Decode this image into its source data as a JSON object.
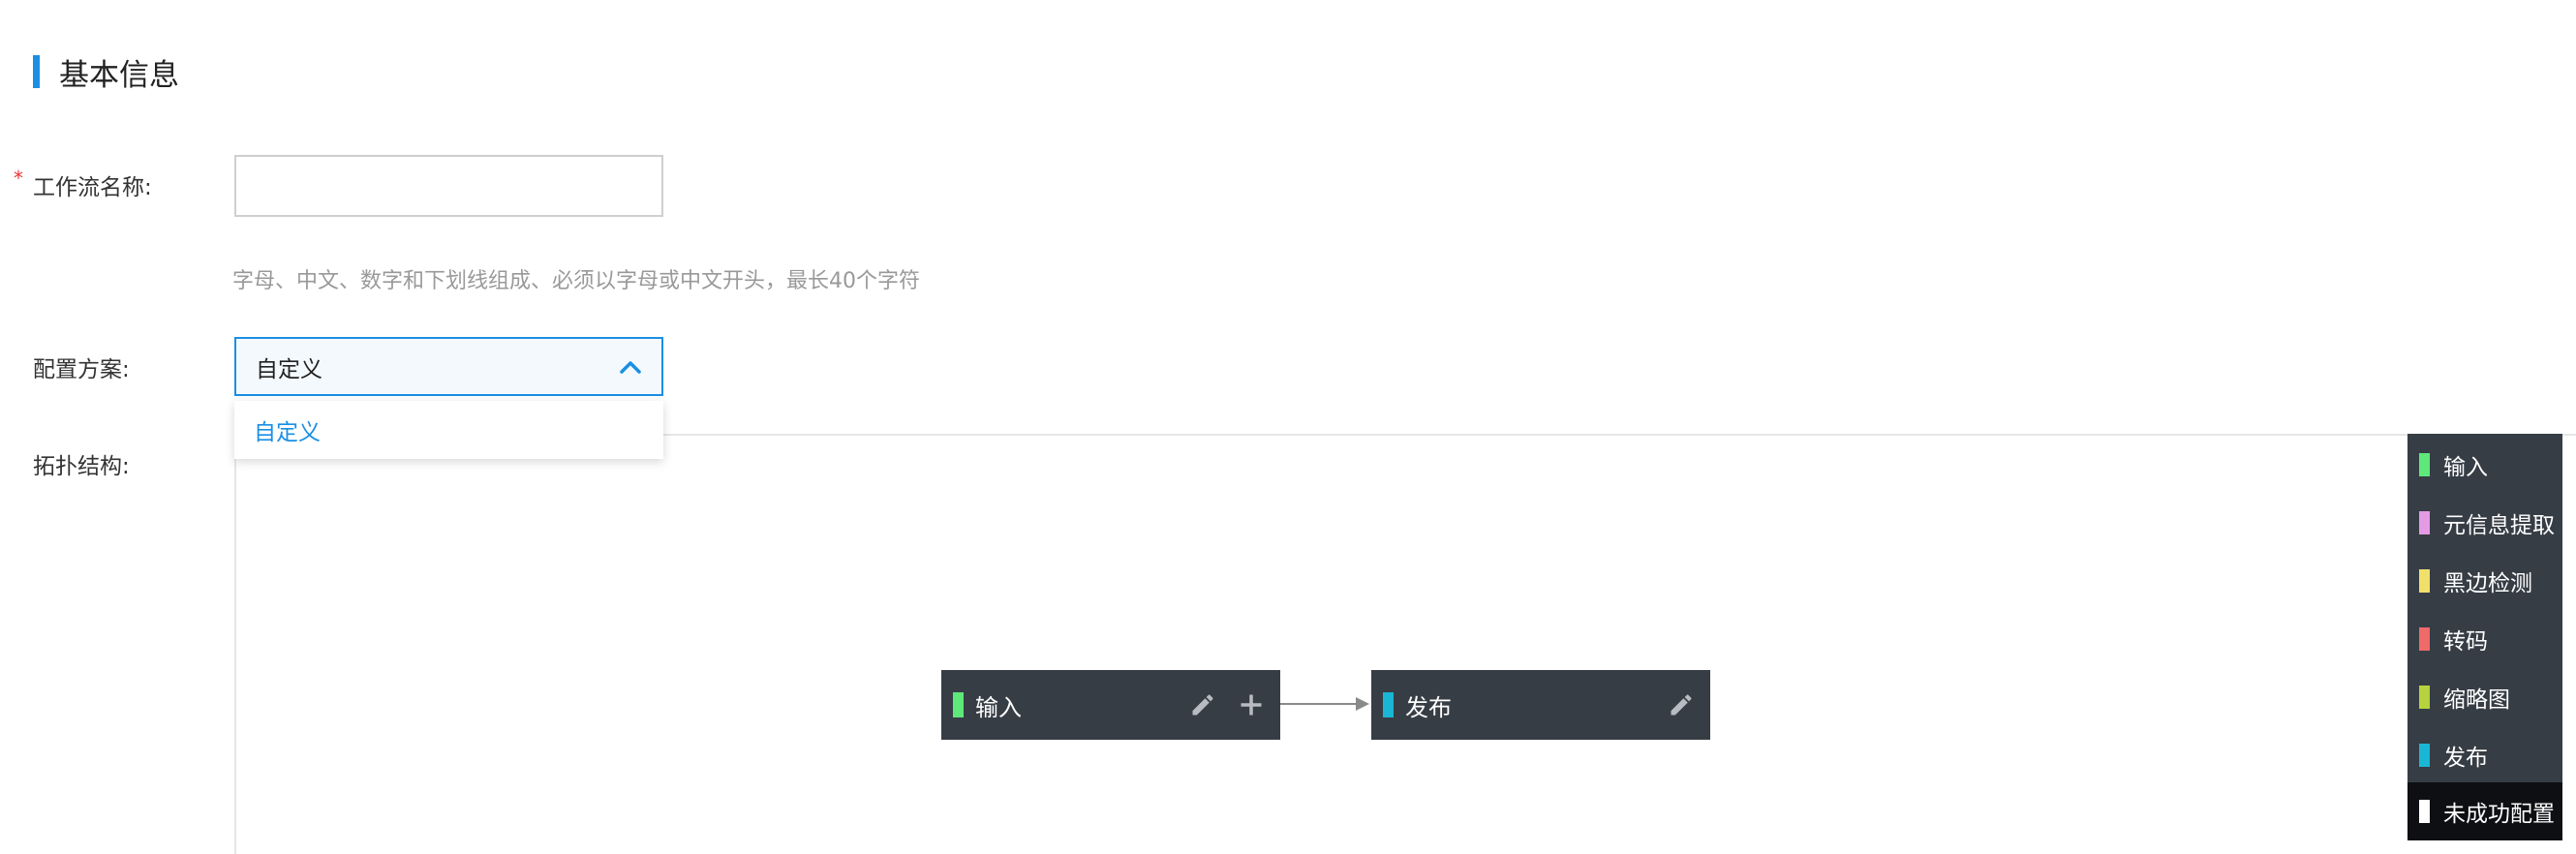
{
  "section": {
    "title": "基本信息"
  },
  "form": {
    "required_mark": "*",
    "name_label": "工作流名称:",
    "name_value": "",
    "name_placeholder": "",
    "name_hint": "字母、中文、数字和下划线组成、必须以字母或中文开头，最长40个字符",
    "scheme_label": "配置方案:",
    "scheme_value": "自定义",
    "scheme_options": [
      "自定义"
    ],
    "topology_label": "拓扑结构:"
  },
  "topology": {
    "nodes": [
      {
        "label": "输入",
        "color": "#5ee87a",
        "actions": [
          "pencil-icon",
          "plus-icon"
        ]
      },
      {
        "label": "发布",
        "color": "#1ab6d6",
        "actions": [
          "pencil-icon"
        ]
      }
    ],
    "edges": [
      {
        "from": "输入",
        "to": "发布"
      }
    ]
  },
  "legend": {
    "items": [
      {
        "label": "输入",
        "color": "#5ee87a"
      },
      {
        "label": "元信息提取",
        "color": "#e59ae6"
      },
      {
        "label": "黑边检测",
        "color": "#f0e06a"
      },
      {
        "label": "转码",
        "color": "#f06a6a"
      },
      {
        "label": "缩略图",
        "color": "#b6d23c"
      },
      {
        "label": "发布",
        "color": "#1ab6d6"
      },
      {
        "label": "未成功配置",
        "color": "#ffffff"
      }
    ]
  },
  "colors": {
    "accent": "#1a8fe3",
    "node_bg": "#373d45",
    "required": "#ee3333"
  }
}
